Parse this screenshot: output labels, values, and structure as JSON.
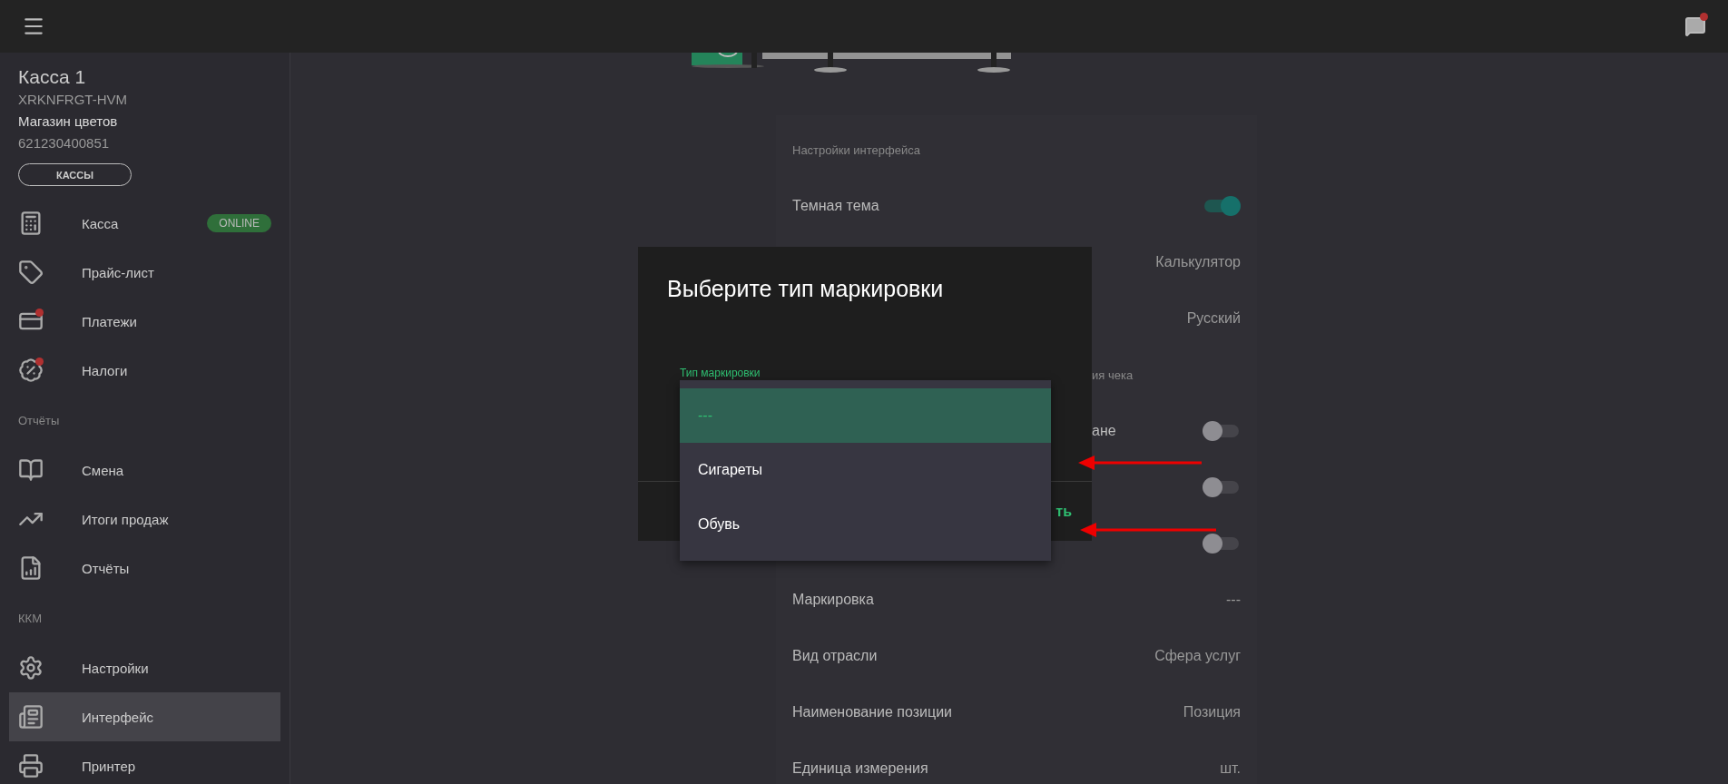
{
  "sidebar": {
    "register": {
      "title": "Касса 1",
      "serial": "XRKNFRGT-HVM",
      "shop": "Магазин цветов",
      "inn": "621230400851",
      "button": "КАССЫ"
    },
    "items": [
      {
        "kind": "item",
        "label": "Касса",
        "status": "ONLINE",
        "badge": false,
        "selected": false
      },
      {
        "kind": "item",
        "label": "Прайс-лист",
        "badge": false,
        "selected": false
      },
      {
        "kind": "item",
        "label": "Платежи",
        "badge": true,
        "selected": false
      },
      {
        "kind": "item",
        "label": "Налоги",
        "badge": true,
        "selected": false
      },
      {
        "kind": "section",
        "label": "Отчёты"
      },
      {
        "kind": "item",
        "label": "Смена",
        "badge": false,
        "selected": false
      },
      {
        "kind": "item",
        "label": "Итоги продаж",
        "badge": false,
        "selected": false
      },
      {
        "kind": "item",
        "label": "Отчёты",
        "badge": false,
        "selected": false
      },
      {
        "kind": "section",
        "label": "ККМ"
      },
      {
        "kind": "item",
        "label": "Настройки",
        "badge": false,
        "selected": false
      },
      {
        "kind": "item",
        "label": "Интерфейс",
        "badge": false,
        "selected": true
      },
      {
        "kind": "item",
        "label": "Принтер",
        "badge": false,
        "selected": false
      }
    ]
  },
  "topbar": {
    "chat_badge": true
  },
  "settings": [
    {
      "kind": "section",
      "label": "Настройки интерфейса"
    },
    {
      "kind": "toggle",
      "label": "Темная тема",
      "on": true
    },
    {
      "kind": "value",
      "value": "Калькулятор"
    },
    {
      "kind": "value",
      "value": "Русский"
    },
    {
      "kind": "section",
      "label": "ия чека",
      "cut": true
    },
    {
      "kind": "toggle",
      "label": "ане",
      "cut": true,
      "on": false
    },
    {
      "kind": "toggle",
      "on": false
    },
    {
      "kind": "toggle",
      "on": false
    },
    {
      "kind": "value",
      "label": "Маркировка",
      "value": "---"
    },
    {
      "kind": "value",
      "label": "Вид отрасли",
      "value": "Сфера услуг"
    },
    {
      "kind": "value",
      "label": "Наименование позиции",
      "value": "Позиция"
    },
    {
      "kind": "value",
      "label": "Единица измерения",
      "value": "шт."
    }
  ],
  "dialog": {
    "title": "Выберите тип маркировки",
    "field_label": "Тип маркировки",
    "button": "ть",
    "options": [
      {
        "label": "---",
        "selected": true
      },
      {
        "label": "Сигареты",
        "selected": false
      },
      {
        "label": "Обувь",
        "selected": false
      }
    ]
  }
}
